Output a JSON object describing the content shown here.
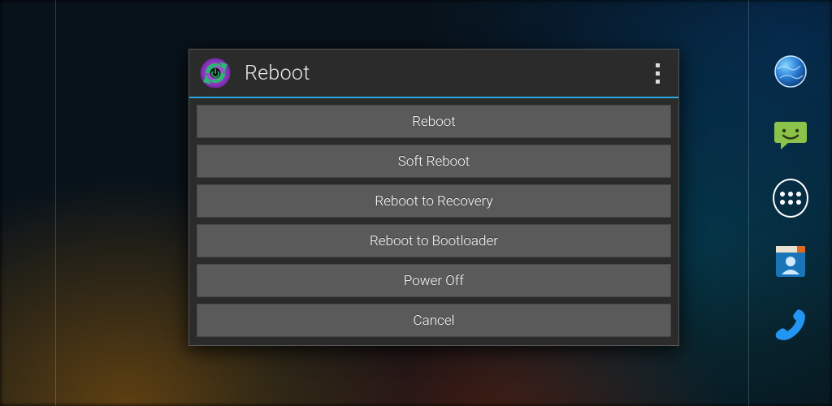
{
  "dialog": {
    "title": "Reboot",
    "options": [
      "Reboot",
      "Soft Reboot",
      "Reboot to Recovery",
      "Reboot to Bootloader",
      "Power Off",
      "Cancel"
    ]
  },
  "dock": {
    "items": [
      "browser-icon",
      "messaging-icon",
      "app-drawer-icon",
      "contacts-icon",
      "phone-icon"
    ]
  },
  "colors": {
    "accent": "#2aa9e0",
    "dialog_bg": "#2b2b2b",
    "button_bg": "#5a5a5a"
  }
}
